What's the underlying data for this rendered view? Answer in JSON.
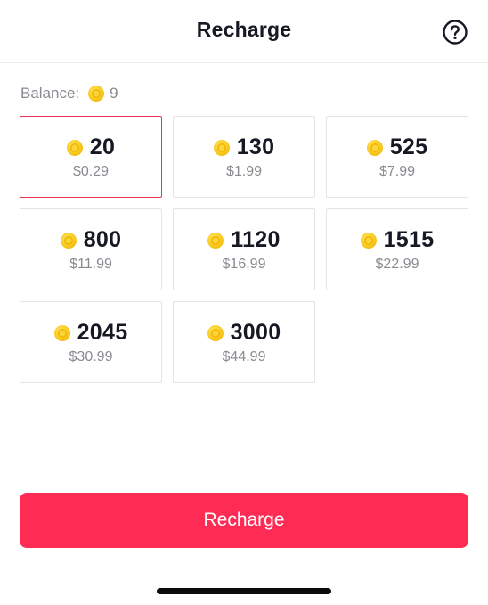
{
  "header": {
    "title": "Recharge",
    "help_icon": "question-circle-icon"
  },
  "balance": {
    "label": "Balance:",
    "icon": "coin-icon",
    "value": "9"
  },
  "packages": [
    {
      "coins": "20",
      "price": "$0.29",
      "selected": true
    },
    {
      "coins": "130",
      "price": "$1.99",
      "selected": false
    },
    {
      "coins": "525",
      "price": "$7.99",
      "selected": false
    },
    {
      "coins": "800",
      "price": "$11.99",
      "selected": false
    },
    {
      "coins": "1120",
      "price": "$16.99",
      "selected": false
    },
    {
      "coins": "1515",
      "price": "$22.99",
      "selected": false
    },
    {
      "coins": "2045",
      "price": "$30.99",
      "selected": false
    },
    {
      "coins": "3000",
      "price": "$44.99",
      "selected": false
    }
  ],
  "action": {
    "recharge_label": "Recharge"
  },
  "colors": {
    "accent": "#fe2c55",
    "selected_border": "#e8324e",
    "coin": "#f8c61a"
  }
}
